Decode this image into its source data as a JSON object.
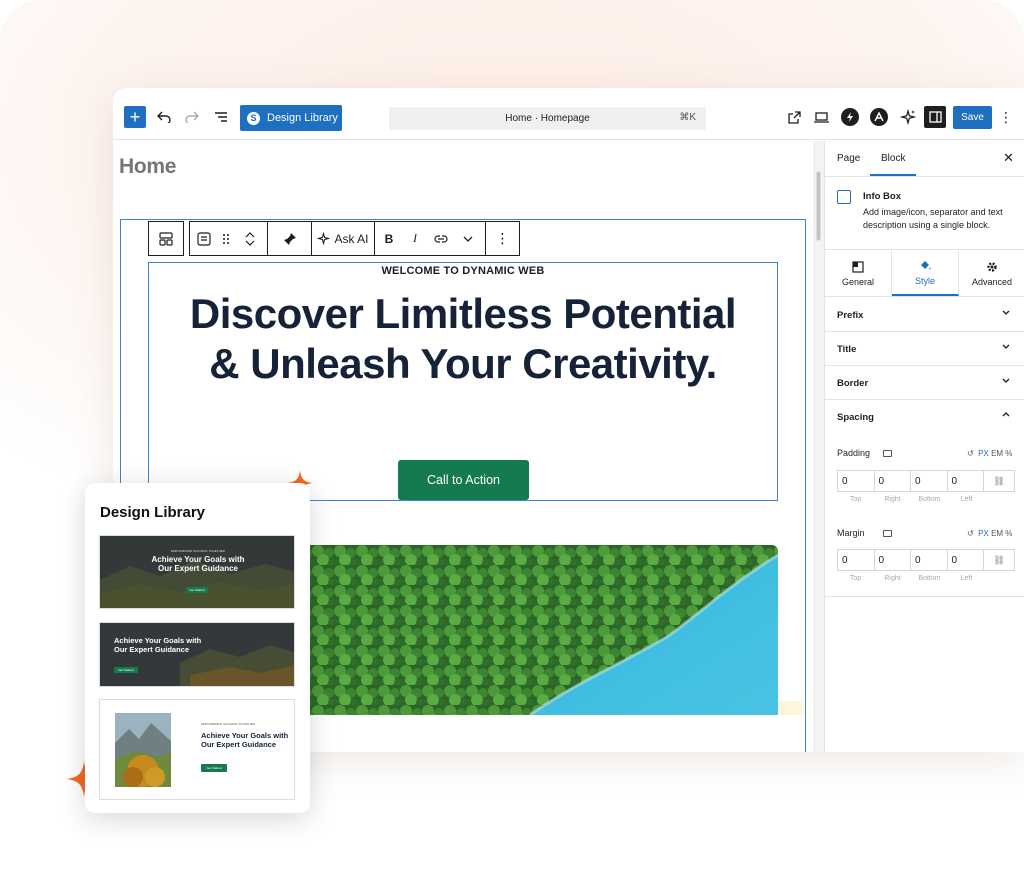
{
  "topbar": {
    "design_library_label": "Design Library",
    "command_title": "Home · Homepage",
    "command_shortcut": "⌘K",
    "save_label": "Save"
  },
  "canvas": {
    "page_title": "Home",
    "toolbar": {
      "ask_ai_label": "Ask AI",
      "bold_label": "B",
      "italic_label": "I"
    },
    "eyebrow": "WELCOME TO DYNAMIC WEB",
    "headline": "Discover Limitless Potential & Unleash Your Creativity.",
    "cta_label": "Call to Action"
  },
  "panel": {
    "tabs": [
      {
        "label": "Page"
      },
      {
        "label": "Block"
      }
    ],
    "block_name": "Info Box",
    "block_description": "Add image/icon, separator and text description using a single block.",
    "style_tabs": [
      {
        "label": "General"
      },
      {
        "label": "Style"
      },
      {
        "label": "Advanced"
      }
    ],
    "sections": [
      {
        "label": "Prefix"
      },
      {
        "label": "Title"
      },
      {
        "label": "Border"
      },
      {
        "label": "Spacing"
      }
    ],
    "padding": {
      "label": "Padding",
      "units": [
        "PX",
        "EM",
        "%"
      ],
      "values": [
        "0",
        "0",
        "0",
        "0"
      ],
      "sides": [
        "Top",
        "Right",
        "Bottom",
        "Left"
      ]
    },
    "margin": {
      "label": "Margin",
      "units": [
        "PX",
        "EM",
        "%"
      ],
      "values": [
        "0",
        "0",
        "0",
        "0"
      ],
      "sides": [
        "Top",
        "Right",
        "Bottom",
        "Left"
      ]
    }
  },
  "design_library_card": {
    "title": "Design Library",
    "templates": [
      {
        "eyebrow": "EMPOWERING SUCCESS TOGETHER",
        "headline": "Achieve Your Goals with Our Expert Guidance",
        "button": "Get Started"
      },
      {
        "headline": "Achieve Your Goals with Our Expert Guidance",
        "button": "Get Started"
      },
      {
        "eyebrow": "EMPOWERING SUCCESS TOGETHER",
        "headline": "Achieve Your Goals with Our Expert Guidance",
        "button": "Get Started"
      }
    ]
  },
  "colors": {
    "accent_blue": "#1e6fc0",
    "cta_green": "#157a4f",
    "headline_navy": "#152238",
    "sparkle_orange": "#f26a21"
  }
}
